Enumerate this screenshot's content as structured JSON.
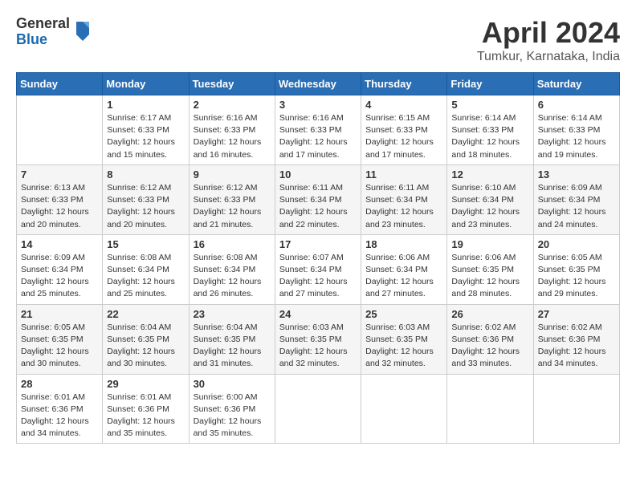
{
  "logo": {
    "general": "General",
    "blue": "Blue"
  },
  "title": "April 2024",
  "subtitle": "Tumkur, Karnataka, India",
  "weekdays": [
    "Sunday",
    "Monday",
    "Tuesday",
    "Wednesday",
    "Thursday",
    "Friday",
    "Saturday"
  ],
  "weeks": [
    [
      {
        "day": "",
        "info": ""
      },
      {
        "day": "1",
        "info": "Sunrise: 6:17 AM\nSunset: 6:33 PM\nDaylight: 12 hours\nand 15 minutes."
      },
      {
        "day": "2",
        "info": "Sunrise: 6:16 AM\nSunset: 6:33 PM\nDaylight: 12 hours\nand 16 minutes."
      },
      {
        "day": "3",
        "info": "Sunrise: 6:16 AM\nSunset: 6:33 PM\nDaylight: 12 hours\nand 17 minutes."
      },
      {
        "day": "4",
        "info": "Sunrise: 6:15 AM\nSunset: 6:33 PM\nDaylight: 12 hours\nand 17 minutes."
      },
      {
        "day": "5",
        "info": "Sunrise: 6:14 AM\nSunset: 6:33 PM\nDaylight: 12 hours\nand 18 minutes."
      },
      {
        "day": "6",
        "info": "Sunrise: 6:14 AM\nSunset: 6:33 PM\nDaylight: 12 hours\nand 19 minutes."
      }
    ],
    [
      {
        "day": "7",
        "info": "Sunrise: 6:13 AM\nSunset: 6:33 PM\nDaylight: 12 hours\nand 20 minutes."
      },
      {
        "day": "8",
        "info": "Sunrise: 6:12 AM\nSunset: 6:33 PM\nDaylight: 12 hours\nand 20 minutes."
      },
      {
        "day": "9",
        "info": "Sunrise: 6:12 AM\nSunset: 6:33 PM\nDaylight: 12 hours\nand 21 minutes."
      },
      {
        "day": "10",
        "info": "Sunrise: 6:11 AM\nSunset: 6:34 PM\nDaylight: 12 hours\nand 22 minutes."
      },
      {
        "day": "11",
        "info": "Sunrise: 6:11 AM\nSunset: 6:34 PM\nDaylight: 12 hours\nand 23 minutes."
      },
      {
        "day": "12",
        "info": "Sunrise: 6:10 AM\nSunset: 6:34 PM\nDaylight: 12 hours\nand 23 minutes."
      },
      {
        "day": "13",
        "info": "Sunrise: 6:09 AM\nSunset: 6:34 PM\nDaylight: 12 hours\nand 24 minutes."
      }
    ],
    [
      {
        "day": "14",
        "info": "Sunrise: 6:09 AM\nSunset: 6:34 PM\nDaylight: 12 hours\nand 25 minutes."
      },
      {
        "day": "15",
        "info": "Sunrise: 6:08 AM\nSunset: 6:34 PM\nDaylight: 12 hours\nand 25 minutes."
      },
      {
        "day": "16",
        "info": "Sunrise: 6:08 AM\nSunset: 6:34 PM\nDaylight: 12 hours\nand 26 minutes."
      },
      {
        "day": "17",
        "info": "Sunrise: 6:07 AM\nSunset: 6:34 PM\nDaylight: 12 hours\nand 27 minutes."
      },
      {
        "day": "18",
        "info": "Sunrise: 6:06 AM\nSunset: 6:34 PM\nDaylight: 12 hours\nand 27 minutes."
      },
      {
        "day": "19",
        "info": "Sunrise: 6:06 AM\nSunset: 6:35 PM\nDaylight: 12 hours\nand 28 minutes."
      },
      {
        "day": "20",
        "info": "Sunrise: 6:05 AM\nSunset: 6:35 PM\nDaylight: 12 hours\nand 29 minutes."
      }
    ],
    [
      {
        "day": "21",
        "info": "Sunrise: 6:05 AM\nSunset: 6:35 PM\nDaylight: 12 hours\nand 30 minutes."
      },
      {
        "day": "22",
        "info": "Sunrise: 6:04 AM\nSunset: 6:35 PM\nDaylight: 12 hours\nand 30 minutes."
      },
      {
        "day": "23",
        "info": "Sunrise: 6:04 AM\nSunset: 6:35 PM\nDaylight: 12 hours\nand 31 minutes."
      },
      {
        "day": "24",
        "info": "Sunrise: 6:03 AM\nSunset: 6:35 PM\nDaylight: 12 hours\nand 32 minutes."
      },
      {
        "day": "25",
        "info": "Sunrise: 6:03 AM\nSunset: 6:35 PM\nDaylight: 12 hours\nand 32 minutes."
      },
      {
        "day": "26",
        "info": "Sunrise: 6:02 AM\nSunset: 6:36 PM\nDaylight: 12 hours\nand 33 minutes."
      },
      {
        "day": "27",
        "info": "Sunrise: 6:02 AM\nSunset: 6:36 PM\nDaylight: 12 hours\nand 34 minutes."
      }
    ],
    [
      {
        "day": "28",
        "info": "Sunrise: 6:01 AM\nSunset: 6:36 PM\nDaylight: 12 hours\nand 34 minutes."
      },
      {
        "day": "29",
        "info": "Sunrise: 6:01 AM\nSunset: 6:36 PM\nDaylight: 12 hours\nand 35 minutes."
      },
      {
        "day": "30",
        "info": "Sunrise: 6:00 AM\nSunset: 6:36 PM\nDaylight: 12 hours\nand 35 minutes."
      },
      {
        "day": "",
        "info": ""
      },
      {
        "day": "",
        "info": ""
      },
      {
        "day": "",
        "info": ""
      },
      {
        "day": "",
        "info": ""
      }
    ]
  ]
}
